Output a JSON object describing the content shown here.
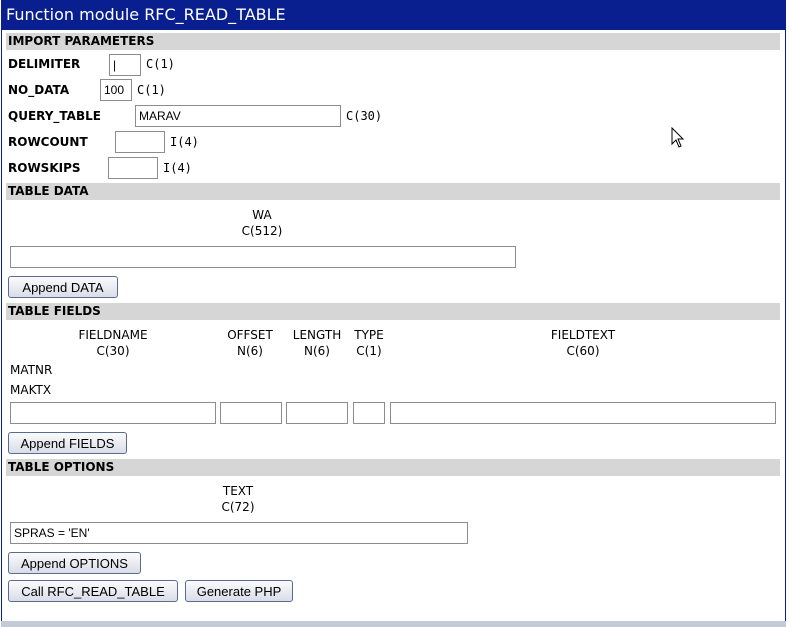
{
  "title": "Function module RFC_READ_TABLE",
  "import": {
    "header": "IMPORT PARAMETERS",
    "delimiter": {
      "label": "DELIMITER",
      "value": "|",
      "type": "C(1)"
    },
    "no_data": {
      "label": "NO_DATA",
      "value": "100",
      "type": "C(1)"
    },
    "query_table": {
      "label": "QUERY_TABLE",
      "value": "MARAV",
      "type": "C(30)"
    },
    "rowcount": {
      "label": "ROWCOUNT",
      "value": "",
      "type": "I(4)"
    },
    "rowskips": {
      "label": "ROWSKIPS",
      "value": "",
      "type": "I(4)"
    }
  },
  "table_data": {
    "header": "TABLE DATA",
    "col_name": "WA",
    "col_type": "C(512)",
    "input_value": "",
    "append_label": "Append DATA"
  },
  "table_fields": {
    "header": "TABLE FIELDS",
    "columns": [
      {
        "name": "FIELDNAME",
        "type": "C(30)"
      },
      {
        "name": "OFFSET",
        "type": "N(6)"
      },
      {
        "name": "LENGTH",
        "type": "N(6)"
      },
      {
        "name": "TYPE",
        "type": "C(1)"
      },
      {
        "name": "FIELDTEXT",
        "type": "C(60)"
      }
    ],
    "rows": [
      "MATNR",
      "MAKTX"
    ],
    "append_label": "Append FIELDS"
  },
  "table_options": {
    "header": "TABLE OPTIONS",
    "col_name": "TEXT",
    "col_type": "C(72)",
    "input_value": "SPRAS = 'EN'",
    "append_label": "Append OPTIONS"
  },
  "actions": {
    "call_label": "Call RFC_READ_TABLE",
    "php_label": "Generate PHP"
  },
  "colors": {
    "titlebar": "#0a1f8f",
    "section": "#d6d6d6"
  }
}
